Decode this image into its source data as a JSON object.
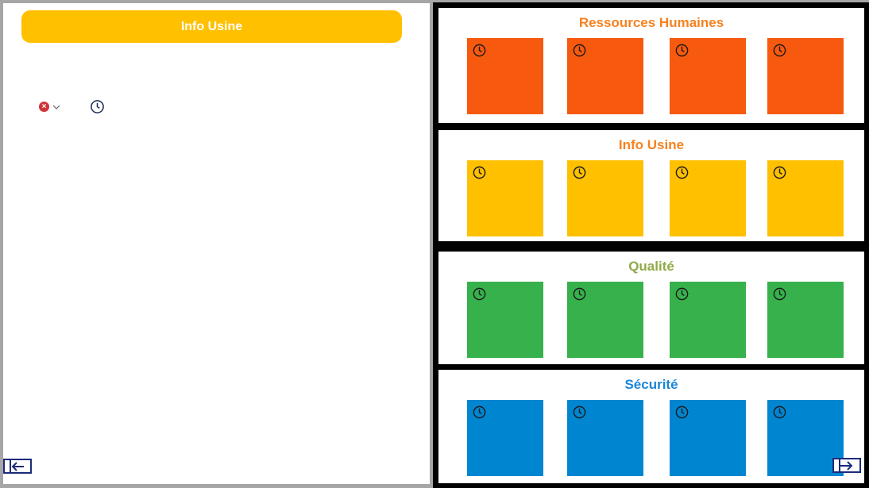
{
  "left_panel": {
    "header": {
      "label": "Info Usine",
      "color": "#ffc000"
    },
    "controls": {
      "clear_icon": "x-circle-icon",
      "dropdown_icon": "chevron-down-icon",
      "time_icon": "clock-icon"
    },
    "back_button_icon": "arrow-left-icon"
  },
  "right_panel": {
    "forward_button_icon": "arrow-right-icon",
    "sections": [
      {
        "title": "Ressources Humaines",
        "title_color": "#f58220",
        "tile_color": "#f7590f",
        "tiles": 4,
        "tile_icon": "clock-icon"
      },
      {
        "title": "Info Usine",
        "title_color": "#f58220",
        "tile_color": "#ffc000",
        "tiles": 4,
        "tile_icon": "clock-icon"
      },
      {
        "title": "Qualité",
        "title_color": "#8faa48",
        "tile_color": "#37b14b",
        "tiles": 4,
        "tile_icon": "clock-icon"
      },
      {
        "title": "Sécurité",
        "title_color": "#1a86d6",
        "tile_color": "#0086d1",
        "tiles": 4,
        "tile_icon": "clock-icon"
      }
    ]
  }
}
